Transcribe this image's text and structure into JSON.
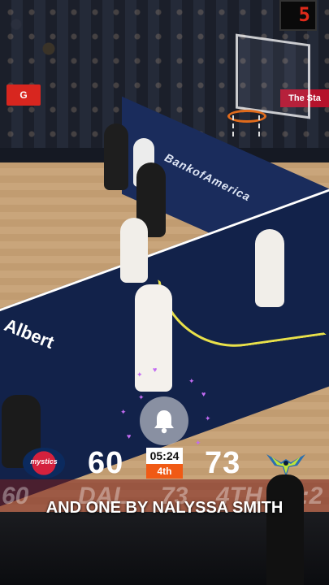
{
  "scoreboard": {
    "home_score": "60",
    "away_score": "73",
    "game_clock": "05:24",
    "period": "4th",
    "home_logo_text": "mystics",
    "home_logo_icon": "washington-mystics-logo",
    "away_logo_icon": "dallas-wings-logo"
  },
  "broadcast_bug": {
    "home_score": "60",
    "away_team": "DAL",
    "away_score": "73",
    "period": "4TH",
    "clock": "5:2"
  },
  "arena": {
    "shot_clock": "5",
    "gatorade_sign": "G",
    "sponsor_board": "The Sta",
    "court_sponsor": "BankofAmerica",
    "floor_sponsor": "Albert"
  },
  "caption": {
    "text": "AND ONE BY NALYSSA SMITH"
  },
  "overlay": {
    "subscribe_icon": "bell-icon"
  },
  "colors": {
    "period_badge": "#f05a15",
    "paint_navy": "#12224a",
    "court_line_yellow": "#e9e14a",
    "sparkle_purple": "#c26bf2"
  }
}
